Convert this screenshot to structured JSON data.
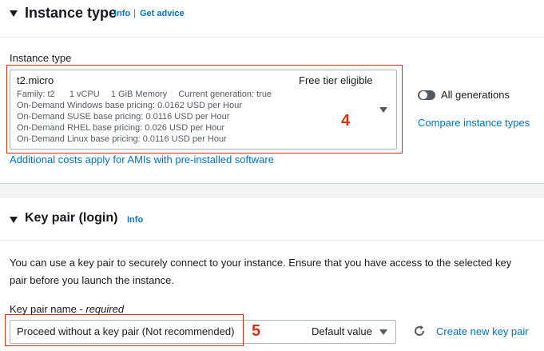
{
  "instance_section": {
    "title": "Instance type",
    "info_link": "Info",
    "separator": "|",
    "advice_link": "Get advice",
    "field_label": "Instance type",
    "selected": {
      "name": "t2.micro",
      "badge": "Free tier eligible",
      "family": "Family: t2",
      "vcpu": "1 vCPU",
      "memory": "1 GiB Memory",
      "generation": "Current generation: true",
      "pricing": [
        "On-Demand Windows base pricing: 0.0162 USD per Hour",
        "On-Demand SUSE base pricing: 0.0116 USD per Hour",
        "On-Demand RHEL base pricing: 0.026 USD per Hour",
        "On-Demand Linux base pricing: 0.0116 USD per Hour"
      ]
    },
    "annotation": "4",
    "all_generations_label": "All generations",
    "compare_link": "Compare instance types",
    "additional_costs_link": "Additional costs apply for AMIs with pre-installed software"
  },
  "keypair_section": {
    "title": "Key pair (login)",
    "info_link": "Info",
    "description": "You can use a key pair to securely connect to your instance. Ensure that you have access to the selected key pair before you launch the instance.",
    "field_label": "Key pair name - ",
    "field_required": "required",
    "selected_value": "Proceed without a key pair (Not recommended)",
    "default_label": "Default value",
    "annotation": "5",
    "create_link": "Create new key pair"
  },
  "colors": {
    "link": "#0073bb",
    "annotation_red": "#d13212",
    "toggle_off": "#545b64"
  }
}
